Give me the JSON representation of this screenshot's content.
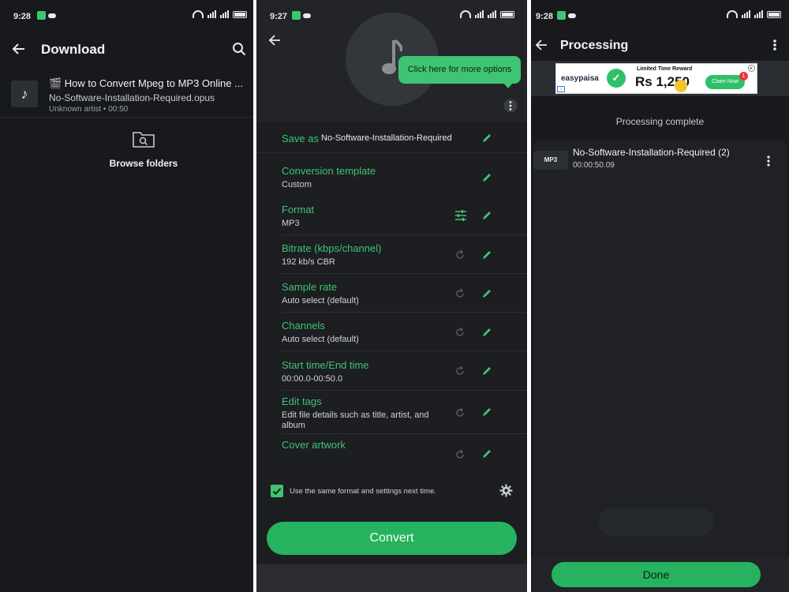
{
  "screen1": {
    "status_time": "9:28",
    "title": "Download",
    "file": {
      "title": "🎬 How to Convert Mpeg to MP3 Online ...",
      "filename": "No-Software-Installation-Required.opus",
      "meta": "Unknown artist • 00:50"
    },
    "browse_label": "Browse folders"
  },
  "screen2": {
    "status_time": "9:27",
    "tooltip": "Click here for more options",
    "save_as_label": "Save as",
    "save_as_value": "No-Software-Installation-Required",
    "rows": [
      {
        "title": "Conversion template",
        "value": "Custom"
      },
      {
        "title": "Format",
        "value": "MP3"
      },
      {
        "title": "Bitrate (kbps/channel)",
        "value": "192 kb/s CBR"
      },
      {
        "title": "Sample rate",
        "value": "Auto select (default)"
      },
      {
        "title": "Channels",
        "value": "Auto select (default)"
      },
      {
        "title": "Start time/End time",
        "value": "00:00.0-00:50.0"
      },
      {
        "title": "Edit tags",
        "value": "Edit file details such as title, artist, and album"
      },
      {
        "title": "Cover artwork",
        "value": ""
      }
    ],
    "checkbox_label": "Use the same format and settings next time.",
    "checkbox_checked": true,
    "convert_label": "Convert"
  },
  "screen3": {
    "status_time": "9:28",
    "title": "Processing",
    "ad": {
      "brand": "easypaisa",
      "headline": "Limited Time Reward",
      "amount": "Rs 1,250",
      "cta": "Claim Now",
      "badge": "1"
    },
    "status_text": "Processing complete",
    "result": {
      "badge": "MP3",
      "name": "No-Software-Installation-Required (2)",
      "duration": "00:00:50.09"
    },
    "done_label": "Done"
  },
  "colors": {
    "accent": "#3ec472",
    "button": "#27b25f",
    "background": "#17191c"
  }
}
